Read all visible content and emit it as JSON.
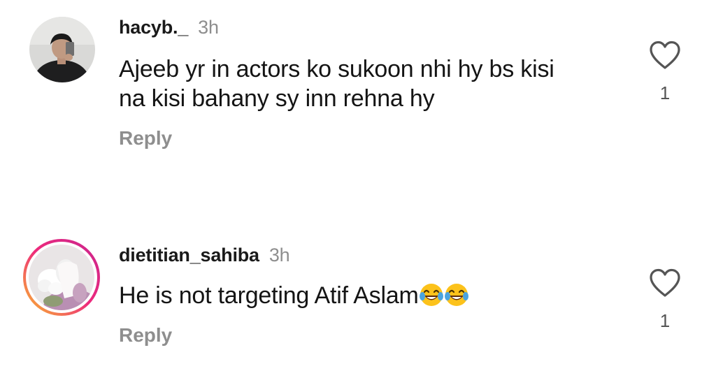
{
  "comments": [
    {
      "username": "hacyb._",
      "time": "3h",
      "lines": [
        "Ajeeb yr in actors ko sukoon nhi hy bs kisi",
        "na kisi bahany sy inn rehna hy"
      ],
      "reply_label": "Reply",
      "like_count": "1",
      "avatar_icon": "profile-photo"
    },
    {
      "username": "dietitian_sahiba",
      "time": "3h",
      "text": "He is not targeting Atif Aslam",
      "emojis": [
        "laughing-crying-emoji",
        "laughing-crying-emoji"
      ],
      "reply_label": "Reply",
      "like_count": "1",
      "avatar_icon": "profile-photo-story-ring"
    }
  ],
  "colors": {
    "text": "#141414",
    "muted": "#8e8e8e",
    "story_ring_start": "#f9c02b",
    "story_ring_end": "#c9258f"
  }
}
